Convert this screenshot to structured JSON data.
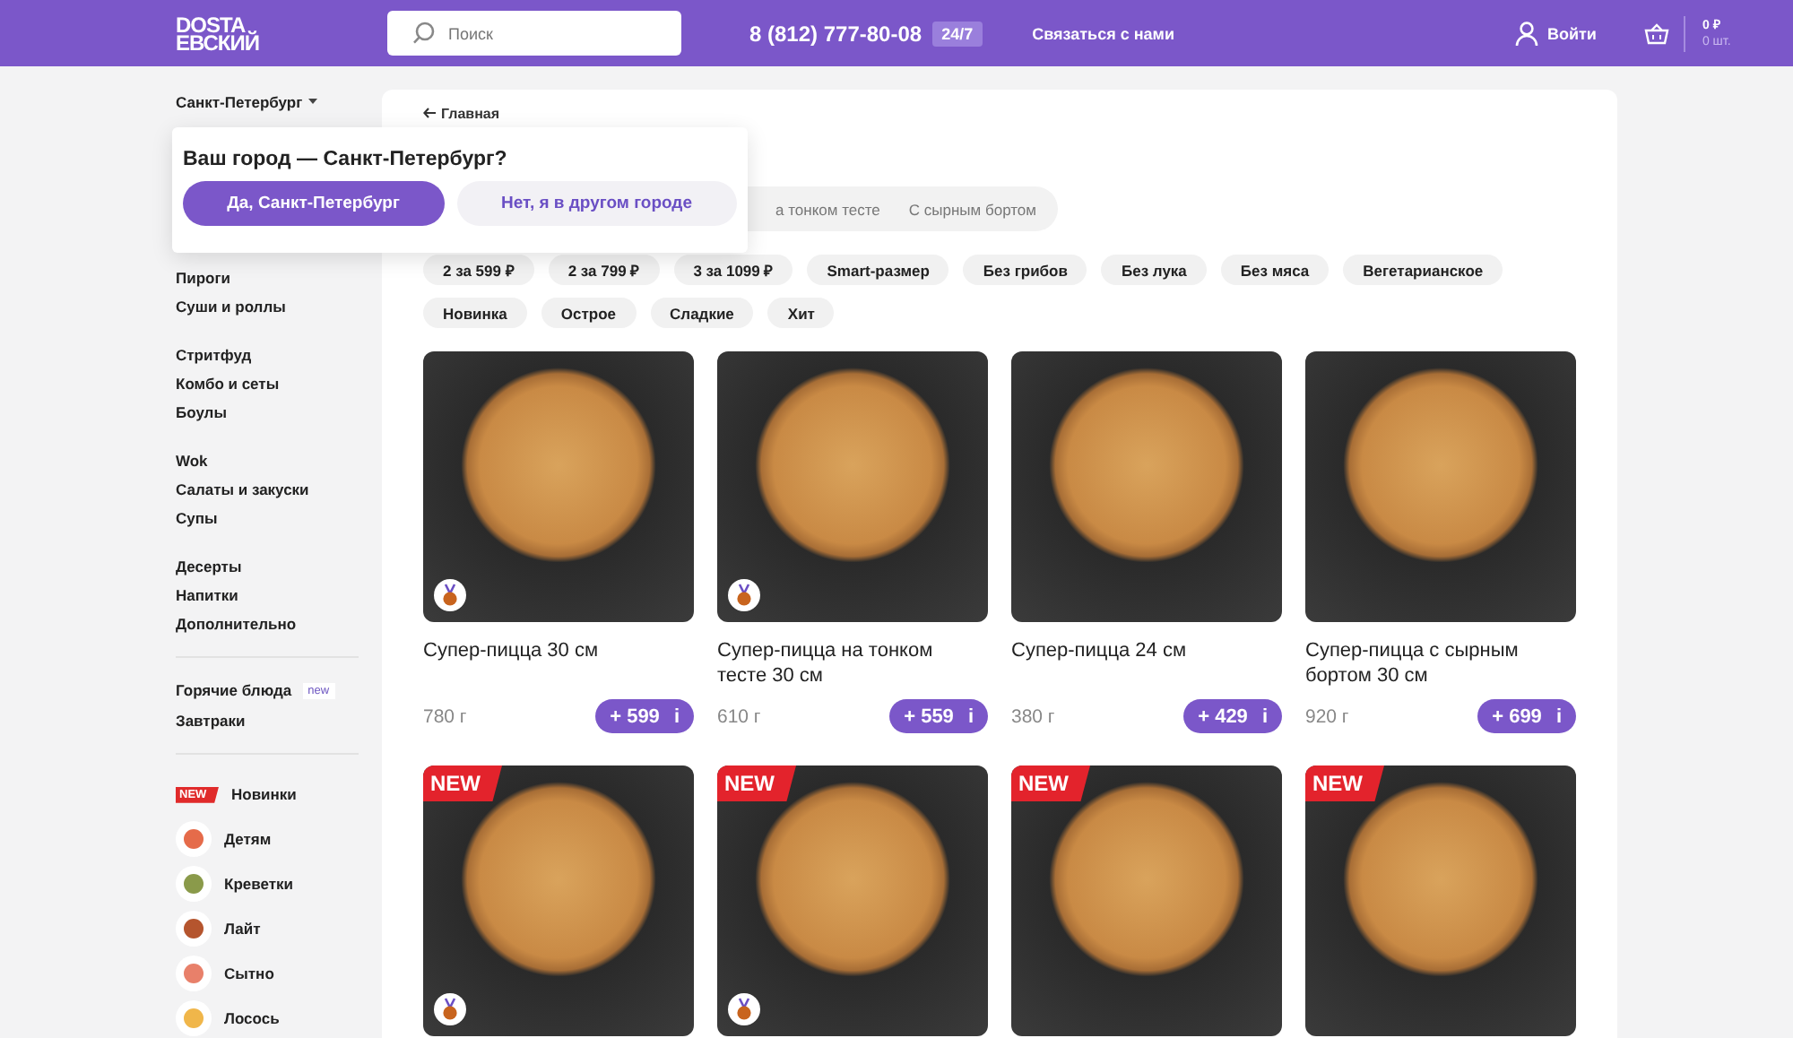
{
  "header": {
    "logo_lines": [
      "DOSTA",
      "ЕВСКИЙ"
    ],
    "search": {
      "placeholder": "Поиск"
    },
    "phone": "8 (812) 777-80-08",
    "hours_badge": "24/7",
    "contact_link": "Связаться с нами",
    "login": "Войти",
    "cart": {
      "sum": "0 ₽",
      "count": "0 шт."
    }
  },
  "sidebar": {
    "city": "Санкт-Петербург",
    "groups": [
      {
        "items": [
          {
            "label": "Пироги"
          },
          {
            "label": "Суши и роллы"
          }
        ]
      },
      {
        "items": [
          {
            "label": "Стритфуд"
          },
          {
            "label": "Комбо и сеты"
          },
          {
            "label": "Боулы"
          }
        ]
      },
      {
        "items": [
          {
            "label": "Wok"
          },
          {
            "label": "Салаты и закуски"
          },
          {
            "label": "Супы"
          }
        ]
      },
      {
        "items": [
          {
            "label": "Десерты"
          },
          {
            "label": "Напитки"
          },
          {
            "label": "Дополнительно"
          }
        ]
      },
      {
        "divider": true,
        "items": [
          {
            "label": "Горячие блюда",
            "badge": "new"
          },
          {
            "label": "Завтраки"
          }
        ]
      }
    ],
    "featured": [
      {
        "kind": "badge",
        "badge": "NEW",
        "label": "Новинки"
      },
      {
        "kind": "icon",
        "label": "Детям"
      },
      {
        "kind": "icon",
        "label": "Креветки"
      },
      {
        "kind": "icon",
        "label": "Лайт"
      },
      {
        "kind": "icon",
        "label": "Сытно"
      },
      {
        "kind": "icon",
        "label": "Лосось"
      }
    ]
  },
  "city_popup": {
    "title": "Ваш город — Санкт-Петербург?",
    "buttons": [
      {
        "label": "Да, Санкт-Петербург",
        "kind": "primary"
      },
      {
        "label": "Нет, я в другом городе",
        "kind": "secondary"
      }
    ]
  },
  "breadcrumb": "Главная",
  "tabs": [
    {
      "label": "а тонком тесте"
    },
    {
      "label": "С сырным бортом"
    }
  ],
  "filters": [
    [
      "2 за 599 ₽",
      "2 за 799 ₽",
      "3 за 1099 ₽",
      "Smart-размер",
      "Без грибов",
      "Без лука",
      "Без мяса",
      "Вегетарианское"
    ],
    [
      "Новинка",
      "Острое",
      "Сладкие",
      "Хит"
    ]
  ],
  "products": [
    {
      "name": "Супер-пицца 30 см",
      "weight": "780 г",
      "price": "+ 599",
      "info": "i",
      "medal": true
    },
    {
      "name": "Супер-пицца на тонком тесте 30 см",
      "weight": "610 г",
      "price": "+ 559",
      "info": "i",
      "medal": true
    },
    {
      "name": "Супер-пицца 24 см",
      "weight": "380 г",
      "price": "+ 429",
      "info": "i",
      "medal": false
    },
    {
      "name": "Супер-пицца с сырным бортом 30 см",
      "weight": "920 г",
      "price": "+ 699",
      "info": "i",
      "medal": false
    },
    {
      "badge": "NEW",
      "medal": true
    },
    {
      "badge": "NEW",
      "medal": true
    },
    {
      "badge": "NEW",
      "medal": false
    },
    {
      "badge": "NEW",
      "medal": false
    }
  ]
}
